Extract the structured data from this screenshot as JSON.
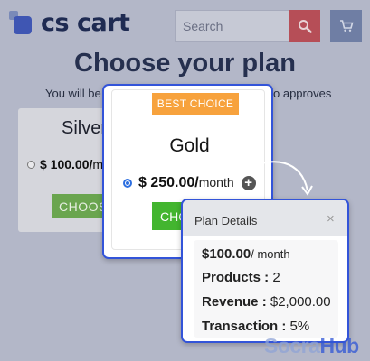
{
  "header": {
    "logo_text": "cs cart",
    "search_placeholder": "Search",
    "search_icon": "search-icon",
    "cart_icon": "cart-icon"
  },
  "page": {
    "title": "Choose your plan",
    "subtitle_left": "You will be",
    "subtitle_right": "o approves"
  },
  "plans": {
    "silver": {
      "name": "Silver",
      "price": "$ 100.00/",
      "unit": "m",
      "choose_label": "CHOOS"
    },
    "gold": {
      "badge": "BEST CHOICE",
      "name": "Gold",
      "price": "$ 250.00/",
      "unit": "month",
      "choose_label": "CHO",
      "selected": true
    }
  },
  "plan_details": {
    "title": "Plan Details",
    "close_symbol": "×",
    "price": "$100.00",
    "price_unit": "/ month",
    "products_label": "Products :",
    "products_value": "2",
    "revenue_label": "Revenue :",
    "revenue_value": "$2,000.00",
    "transaction_label": "Transaction :",
    "transaction_value": "5%"
  },
  "watermark": {
    "part1": "Socra",
    "part2": "Hub"
  },
  "colors": {
    "accent_blue": "#3354d9",
    "badge_orange": "#f7a23d",
    "choose_green": "#43b52f",
    "overlay": "#b3b7c8"
  }
}
